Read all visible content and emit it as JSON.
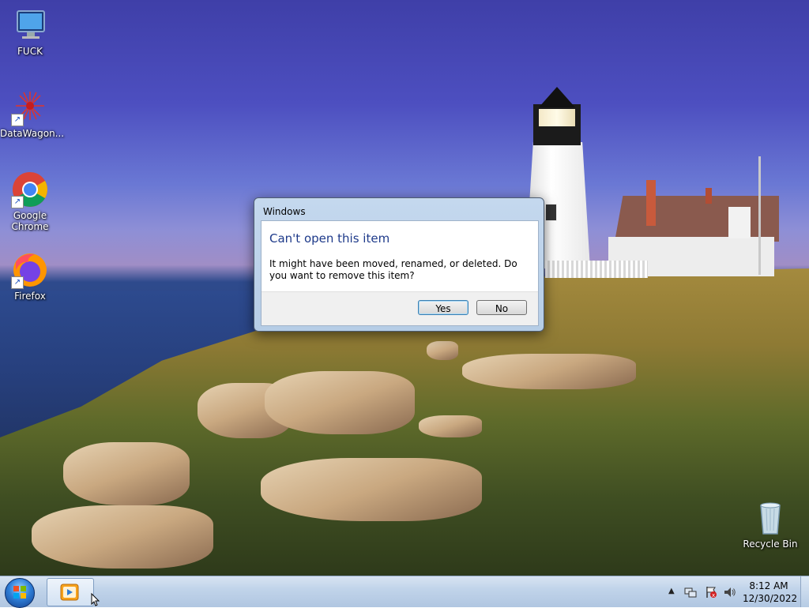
{
  "desktop": {
    "icons": [
      {
        "label": "FUCK",
        "icon": "computer-icon"
      },
      {
        "label": "DataWagon...",
        "icon": "datawagon-icon"
      },
      {
        "label": "Google Chrome",
        "icon": "chrome-icon"
      },
      {
        "label": "Firefox",
        "icon": "firefox-icon"
      },
      {
        "label": "Recycle Bin",
        "icon": "recycle-bin-icon"
      }
    ]
  },
  "dialog": {
    "title": "Windows",
    "heading": "Can't open this item",
    "message": "It might have been moved, renamed, or deleted. Do you want to remove this item?",
    "yes_label": "Yes",
    "no_label": "No"
  },
  "taskbar": {
    "start_icon": "windows-start-icon",
    "pinned": [
      {
        "icon": "media-player-icon"
      }
    ],
    "tray": {
      "icons": [
        "show-hidden-icons-arrow",
        "network-icon",
        "action-center-flag-icon",
        "volume-icon"
      ],
      "time": "8:12 AM",
      "date": "12/30/2022"
    }
  },
  "colors": {
    "dialog_heading": "#1e3a8a",
    "taskbar": "#c1d4ea"
  }
}
